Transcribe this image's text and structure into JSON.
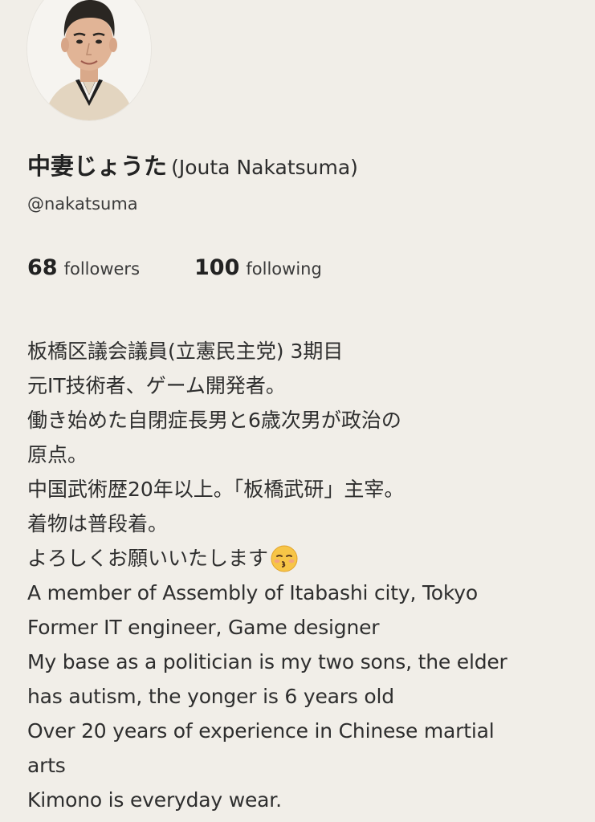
{
  "profile": {
    "name_jp": "中妻じょうた",
    "name_en": "(Jouta Nakatsuma)",
    "handle": "@nakatsuma",
    "avatar_icon": "profile-photo"
  },
  "stats": {
    "followers_count": "68",
    "followers_label": "followers",
    "following_count": "100",
    "following_label": "following"
  },
  "bio": {
    "lines": [
      "板橋区議会議員(立憲民主党) 3期目",
      "元IT技術者、ゲーム開発者。",
      "働き始めた自閉症長男と6歳次男が政治の",
      "原点。",
      "中国武術歴20年以上。「板橋武研」主宰。",
      "着物は普段着。",
      "よろしくお願いいたします",
      "A member of Assembly of Itabashi city, Tokyo",
      "Former IT engineer, Game designer",
      "My base as a politician is my two sons, the elder",
      "has autism, the yonger is 6 years old",
      "Over 20 years of experience in Chinese martial",
      "arts",
      "Kimono is everyday wear."
    ],
    "emoji_icon": "kissing-face-emoji"
  }
}
